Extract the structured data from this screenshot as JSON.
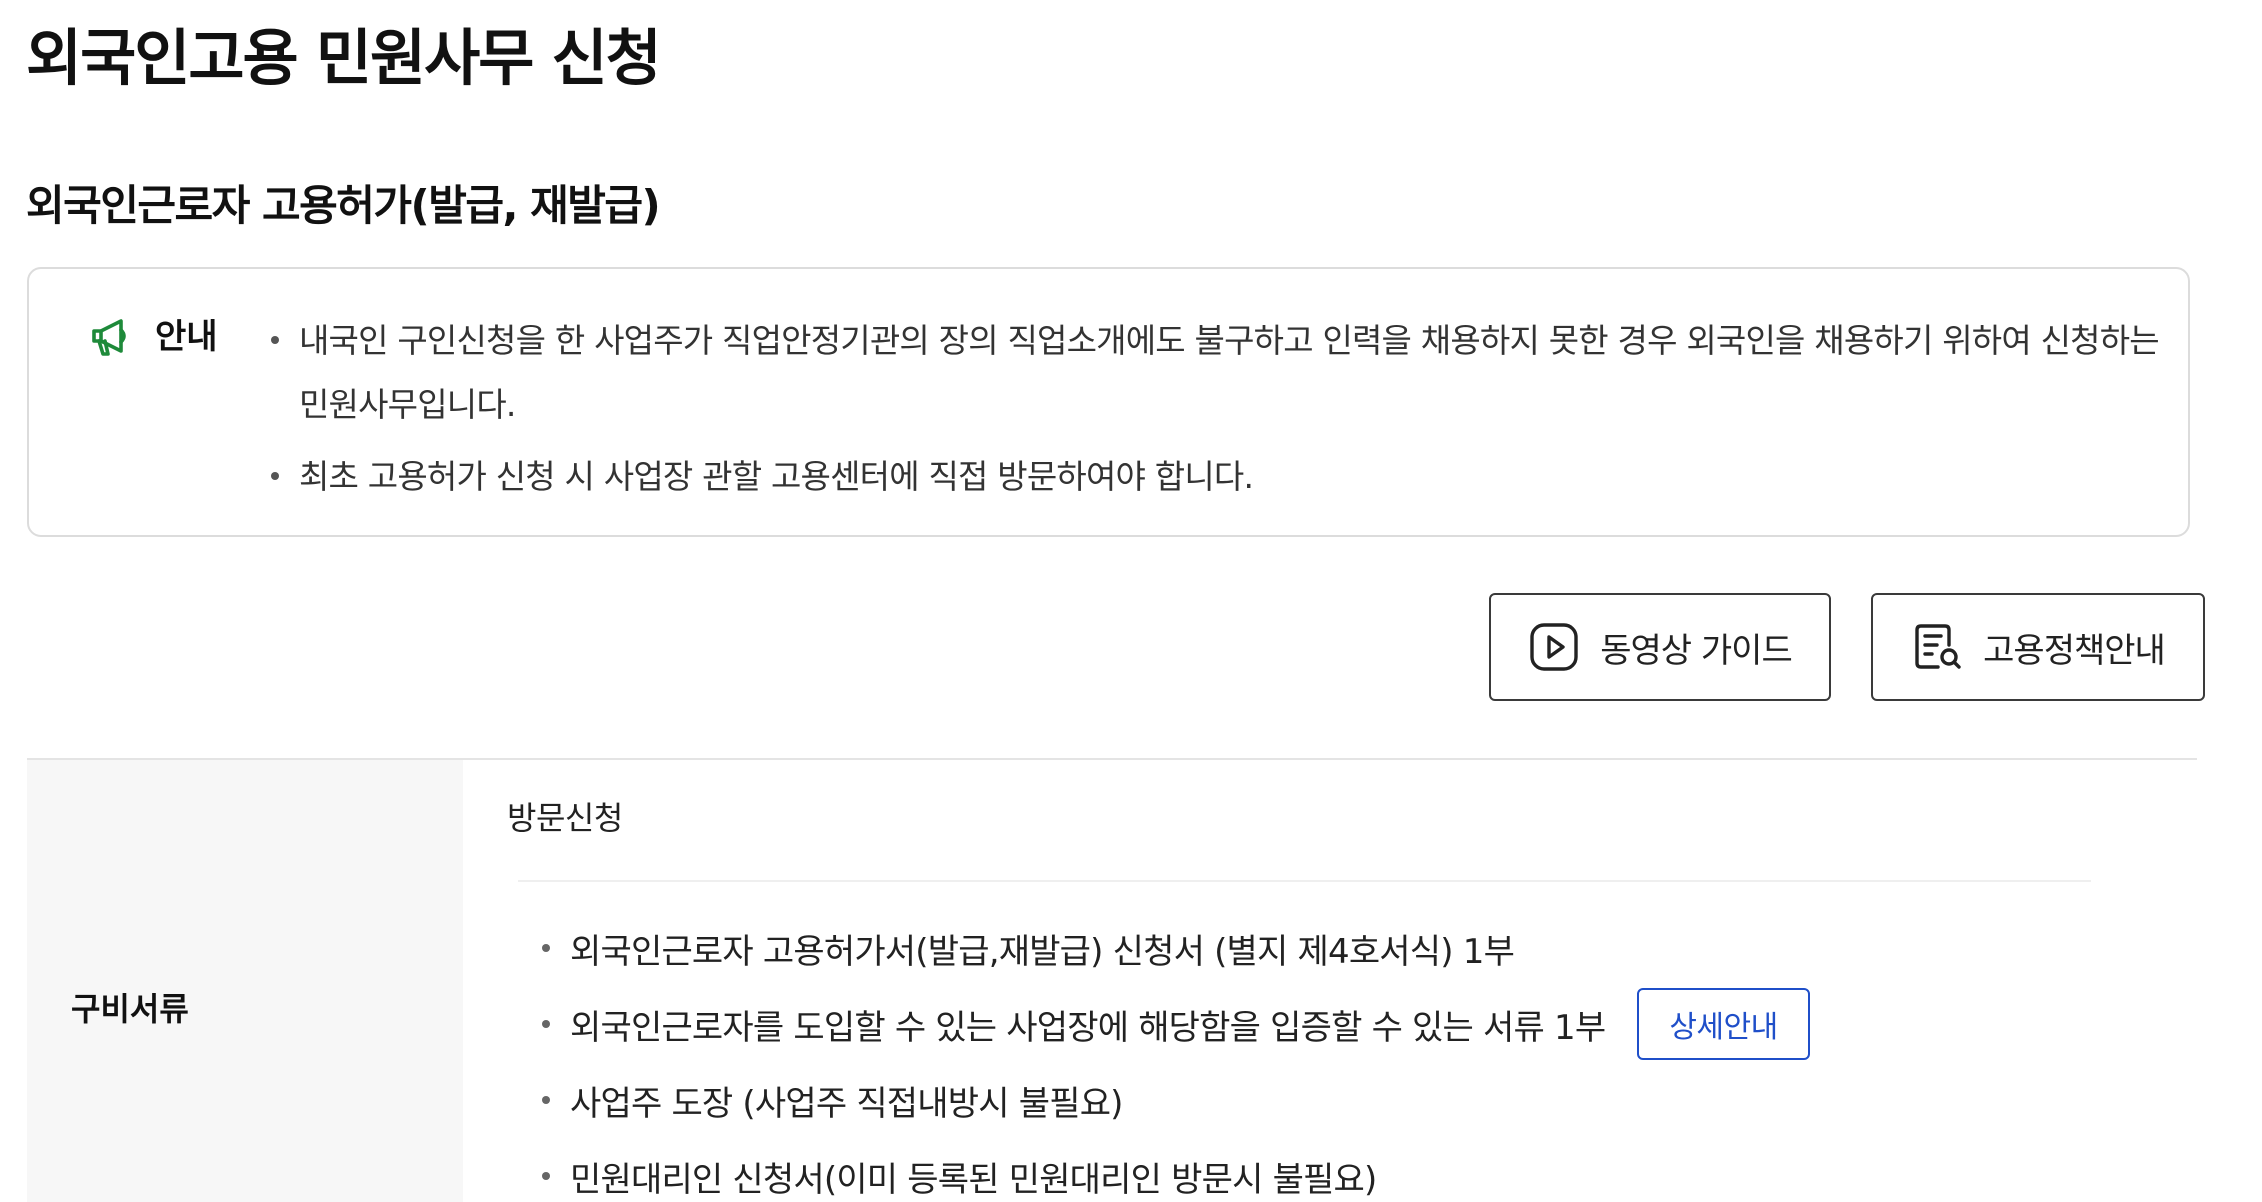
{
  "page": {
    "title": "외국인고용 민원사무 신청"
  },
  "section": {
    "title": "외국인근로자 고용허가(발급, 재발급)"
  },
  "notice": {
    "label": "안내",
    "icon": "megaphone-icon",
    "icon_color": "#1e8a3a",
    "items": [
      "내국인 구인신청을 한 사업주가 직업안정기관의 장의 직업소개에도 불구하고 인력을 채용하지 못한 경우 외국인을 채용하기 위하여 신청하는 민원사무입니다.",
      "최초 고용허가 신청 시 사업장 관할 고용센터에 직접 방문하여야 합니다."
    ]
  },
  "buttons": {
    "video_guide": {
      "label": "동영상 가이드",
      "icon": "play-icon"
    },
    "policy_info": {
      "label": "고용정책안내",
      "icon": "document-search-icon"
    }
  },
  "requirements": {
    "label": "구비서류",
    "method": "방문신청",
    "documents": [
      "외국인근로자 고용허가서(발급,재발급) 신청서 (별지 제4호서식) 1부",
      "외국인근로자를 도입할 수 있는 사업장에 해당함을 입증할 수 있는 서류 1부",
      "사업주 도장 (사업주 직접내방시 불필요)",
      "민원대리인 신청서(이미 등록된 민원대리인 방문시 불필요)"
    ],
    "detail_button": {
      "label": "상세안내",
      "color": "#1f4fc9"
    }
  }
}
